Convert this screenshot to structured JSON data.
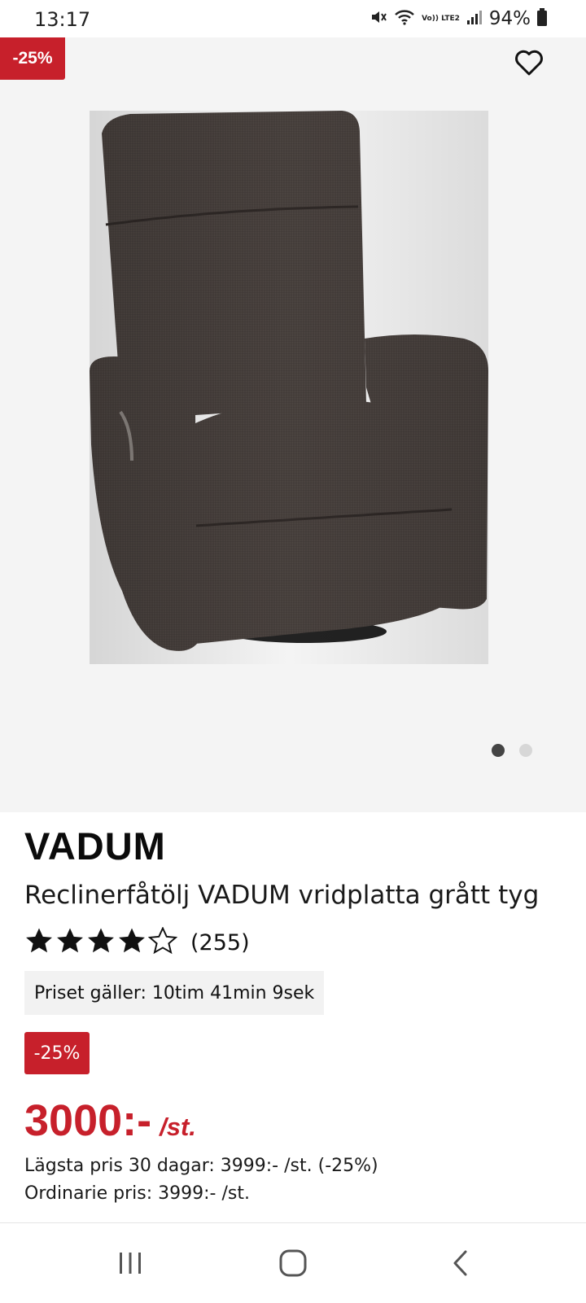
{
  "status_bar": {
    "time": "13:17",
    "network_label": "Vo)) LTE2",
    "battery": "94%",
    "icons": [
      "mute-icon",
      "wifi-icon",
      "signal-icon",
      "battery-icon"
    ]
  },
  "hero": {
    "discount_badge": "-25%",
    "favorite_icon": "heart-outline-icon",
    "carousel": {
      "total": 2,
      "active": 1
    }
  },
  "product": {
    "brand": "VADUM",
    "name": "Reclinerfåtölj VADUM vridplatta grått tyg",
    "rating": {
      "stars": 4,
      "max": 5,
      "count_label": "(255)"
    },
    "timer": "Priset gäller: 10tim 41min 9sek",
    "discount_badge": "-25%",
    "price": "3000:-",
    "price_unit": "/st.",
    "lowest_price_note": "Lägsta pris 30 dagar: 3999:- /st. (-25%)",
    "ordinary_price_note": "Ordinarie pris: 3999:- /st."
  },
  "colors": {
    "accent_red": "#c7202b",
    "hero_bg": "#f4f4f4",
    "text": "#111111"
  },
  "nav": {
    "icons": [
      "recent-apps-icon",
      "home-icon",
      "back-icon"
    ]
  }
}
